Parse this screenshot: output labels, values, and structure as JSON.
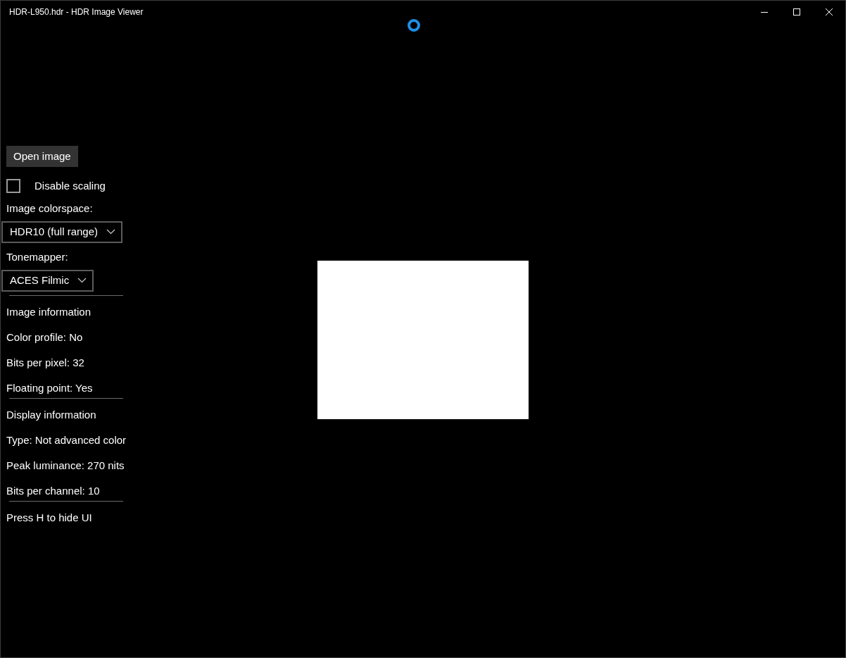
{
  "window": {
    "title": "HDR-L950.hdr - HDR Image Viewer"
  },
  "open_button": "Open image",
  "disable_scaling": {
    "label": "Disable scaling",
    "checked": false
  },
  "colorspace": {
    "label": "Image colorspace:",
    "value": "HDR10 (full range)"
  },
  "tonemapper": {
    "label": "Tonemapper:",
    "value": "ACES Filmic"
  },
  "sections": [
    {
      "lines": [
        "Image information",
        "Color profile: No",
        "Bits per pixel: 32",
        "Floating point: Yes"
      ]
    },
    {
      "lines": [
        "Display information",
        "Type: Not advanced color",
        "Peak luminance: 270 nits",
        "Bits per channel: 10"
      ]
    },
    {
      "lines": [
        "Press H to hide UI"
      ]
    }
  ]
}
